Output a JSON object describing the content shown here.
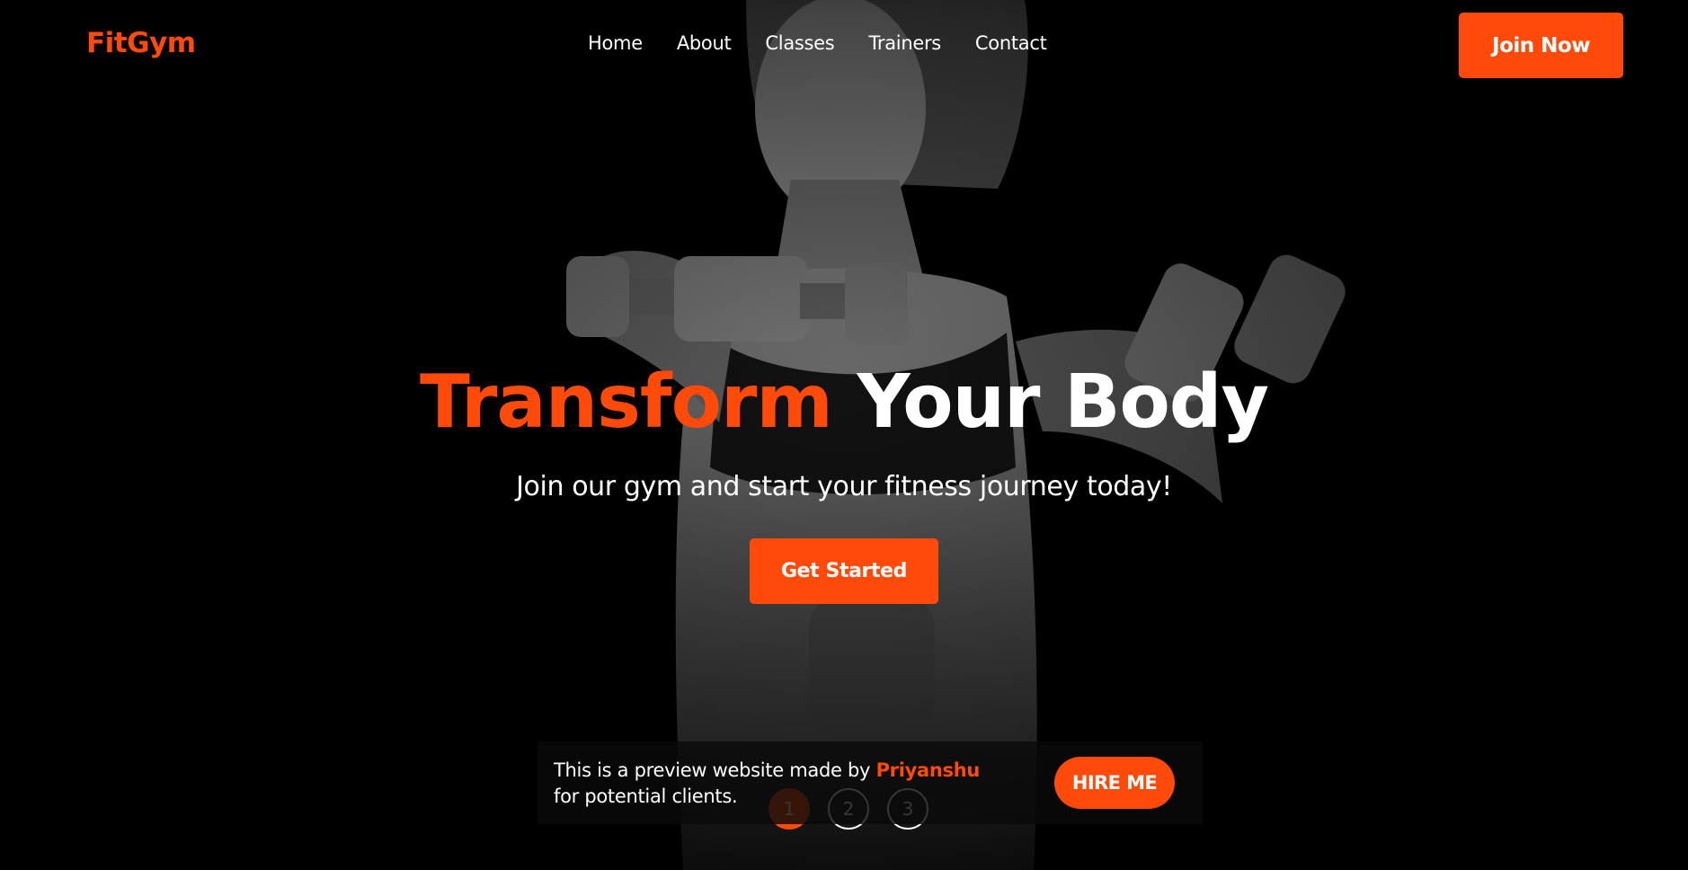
{
  "brand": {
    "logo": "FitGym",
    "accent_color": "#ff4a0a"
  },
  "nav": {
    "links": [
      {
        "label": "Home"
      },
      {
        "label": "About"
      },
      {
        "label": "Classes"
      },
      {
        "label": "Trainers"
      },
      {
        "label": "Contact"
      }
    ],
    "join_label": "Join Now"
  },
  "hero": {
    "title_accent": "Transform",
    "title_rest": "Your Body",
    "subtitle": "Join our gym and start your fitness journey today!",
    "cta_label": "Get Started"
  },
  "slider": {
    "dots": [
      "1",
      "2",
      "3"
    ],
    "active": "1"
  },
  "banner": {
    "text_before": "This is a preview website made by ",
    "name": "Priyanshu",
    "text_after": " for potential clients.",
    "hire_label": "HIRE ME"
  }
}
